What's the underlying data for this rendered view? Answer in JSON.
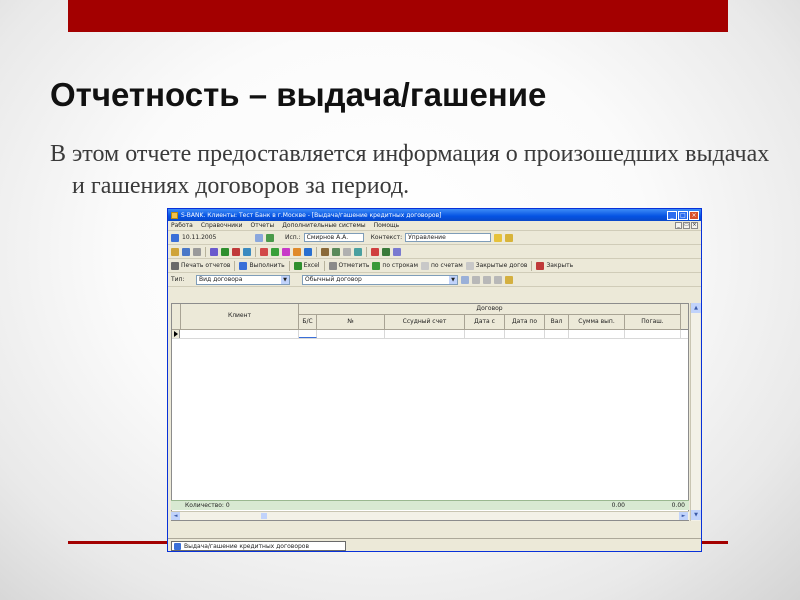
{
  "slide": {
    "title": "Отчетность – выдача/гашение",
    "body": "В этом отчете предоставляется информация о произошедших выдачах и гашениях договоров за период."
  },
  "colors": {
    "accent": "#a30000",
    "titlebar": "#0553e3",
    "summary_row": "#d8e9d2"
  },
  "app": {
    "window_title": "S-BANK. Клиенты: Тест Банк в г.Москве - [Выдача/гашение кредитных договоров]",
    "window_buttons": {
      "minimize": "_",
      "maximize": "□",
      "close": "×"
    },
    "menu": [
      "Работа",
      "Справочники",
      "Отчеты",
      "Дополнительные системы",
      "Помощь"
    ],
    "mdi_buttons": {
      "minimize": "_",
      "restore": "▭",
      "close": "×"
    },
    "toolbar1": {
      "date_label": "10.11.2005",
      "executor_label": "Исп.:",
      "executor_value": "Смирнов А.А.",
      "context_label": "Контекст:",
      "context_value": "Управление"
    },
    "toolbar2": {
      "print": "Печать отчетов",
      "execute": "Выполнить",
      "excel": "Excel",
      "mark": "Отметить",
      "by_rows": "по строкам",
      "by_accounts": "по счетам",
      "closed_docs": "Закрытые догов",
      "close": "Закрыть"
    },
    "filter": {
      "type_label": "Тип:",
      "type_value": "Вид договора",
      "kind_value": "Обычный договор"
    },
    "grid": {
      "group_header": "Договор",
      "col_client": "Клиент",
      "cols": [
        "Б/С",
        "№",
        "Ссудный счет",
        "Дата с",
        "Дата по",
        "Вал",
        "Сумма вып.",
        "Погаш."
      ]
    },
    "summary": {
      "label": "Количество: 0",
      "total1": "0.00",
      "total2": "0.00"
    },
    "taskbar_item": "Выдача/гашение кредитных договоров",
    "scroll_arrows": {
      "up": "▲",
      "down": "▼",
      "left": "◄",
      "right": "►"
    },
    "dropdown_arrow": "▼",
    "icons": [
      "printer-icon",
      "execute-icon",
      "excel-icon",
      "check-icon",
      "filter-icon",
      "close-icon"
    ]
  }
}
